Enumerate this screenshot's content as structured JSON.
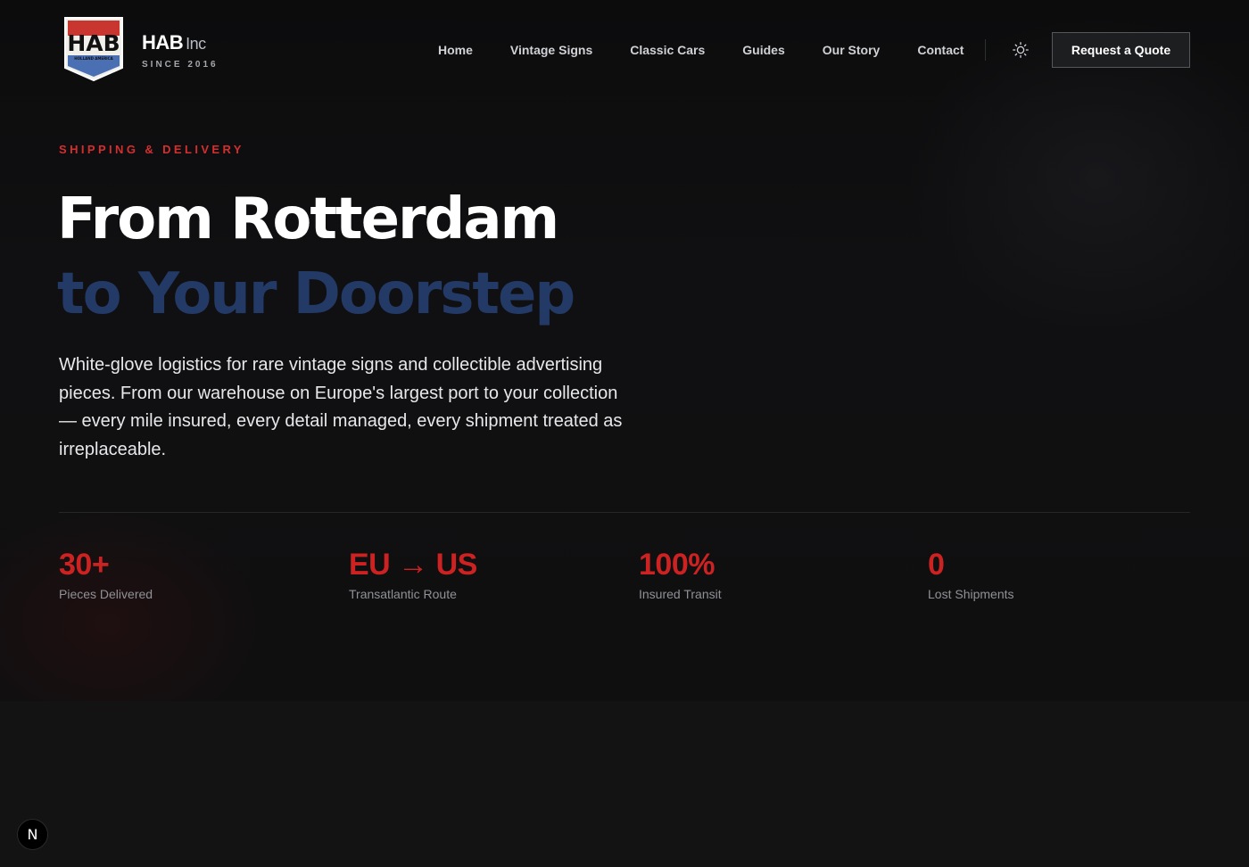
{
  "header": {
    "logo_text": "HAB",
    "logo_tagline": "HOLLAND AMERICA",
    "brand_name": "HAB",
    "brand_suffix": "Inc",
    "brand_since": "SINCE 2016",
    "nav": [
      {
        "label": "Home"
      },
      {
        "label": "Vintage Signs"
      },
      {
        "label": "Classic Cars"
      },
      {
        "label": "Guides"
      },
      {
        "label": "Our Story"
      },
      {
        "label": "Contact"
      }
    ],
    "theme_icon": "sun-icon",
    "cta_label": "Request a Quote"
  },
  "hero": {
    "eyebrow": "SHIPPING & DELIVERY",
    "headline_line1": "From Rotterdam",
    "headline_line2": "to Your Doorstep",
    "lead": "White-glove logistics for rare vintage signs and collectible advertising pieces. From our warehouse on Europe's largest port to your collection — every mile insured, every detail managed, every shipment treated as irreplaceable."
  },
  "stats": [
    {
      "value": "30+",
      "label": "Pieces Delivered"
    },
    {
      "value": "EU → US",
      "label": "Transatlantic Route"
    },
    {
      "value": "100%",
      "label": "Insured Transit"
    },
    {
      "value": "0",
      "label": "Lost Shipments"
    }
  ],
  "dev_badge": {
    "label": "N"
  },
  "colors": {
    "accent_red": "#cc2222",
    "headline_blue": "#233a66",
    "background": "#0f0f10"
  }
}
